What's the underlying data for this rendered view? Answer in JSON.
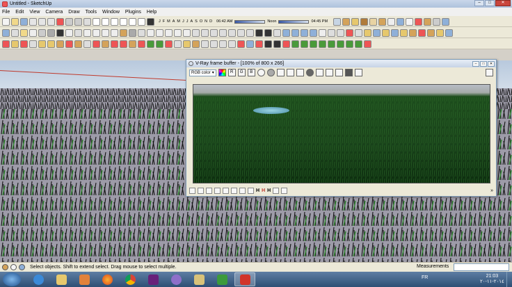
{
  "window": {
    "title": "Untitled - SketchUp",
    "min": "–",
    "max": "□",
    "close": "✕"
  },
  "menu": [
    "File",
    "Edit",
    "View",
    "Camera",
    "Draw",
    "Tools",
    "Window",
    "Plugins",
    "Help"
  ],
  "shadow_settings": {
    "months": [
      "J",
      "F",
      "M",
      "A",
      "M",
      "J",
      "J",
      "A",
      "S",
      "O",
      "N",
      "D"
    ],
    "time_start": "06:42 AM",
    "time_mid": "Noon",
    "time_end": "04:45 PM"
  },
  "vray_frame_buffer": {
    "title": "V-Ray frame buffer - [100% of 800 x 266]",
    "channel_select": "RGB color",
    "channel_toggles": [
      "R",
      "G",
      "B"
    ],
    "bottom_markers": [
      "H",
      "H",
      "H"
    ]
  },
  "status": {
    "hint": "Select objects. Shift to extend select. Drag mouse to select multiple.",
    "measurements_label": "Measurements",
    "measurements_value": ""
  },
  "taskbar": {
    "language": "FR",
    "time": "21:03",
    "date": "٢٠١٤-١١-٢٠",
    "apps": [
      "internet-explorer",
      "file-explorer",
      "media-player",
      "firefox",
      "chrome",
      "visual-studio",
      "app-purple",
      "folder",
      "sketchup",
      "pdf-reader"
    ]
  },
  "colors": {
    "sky": "#c7d5e4",
    "ground": "#9d9ba8",
    "grass_render": "#1d4d1c",
    "taskbar": "#2e4f75"
  }
}
